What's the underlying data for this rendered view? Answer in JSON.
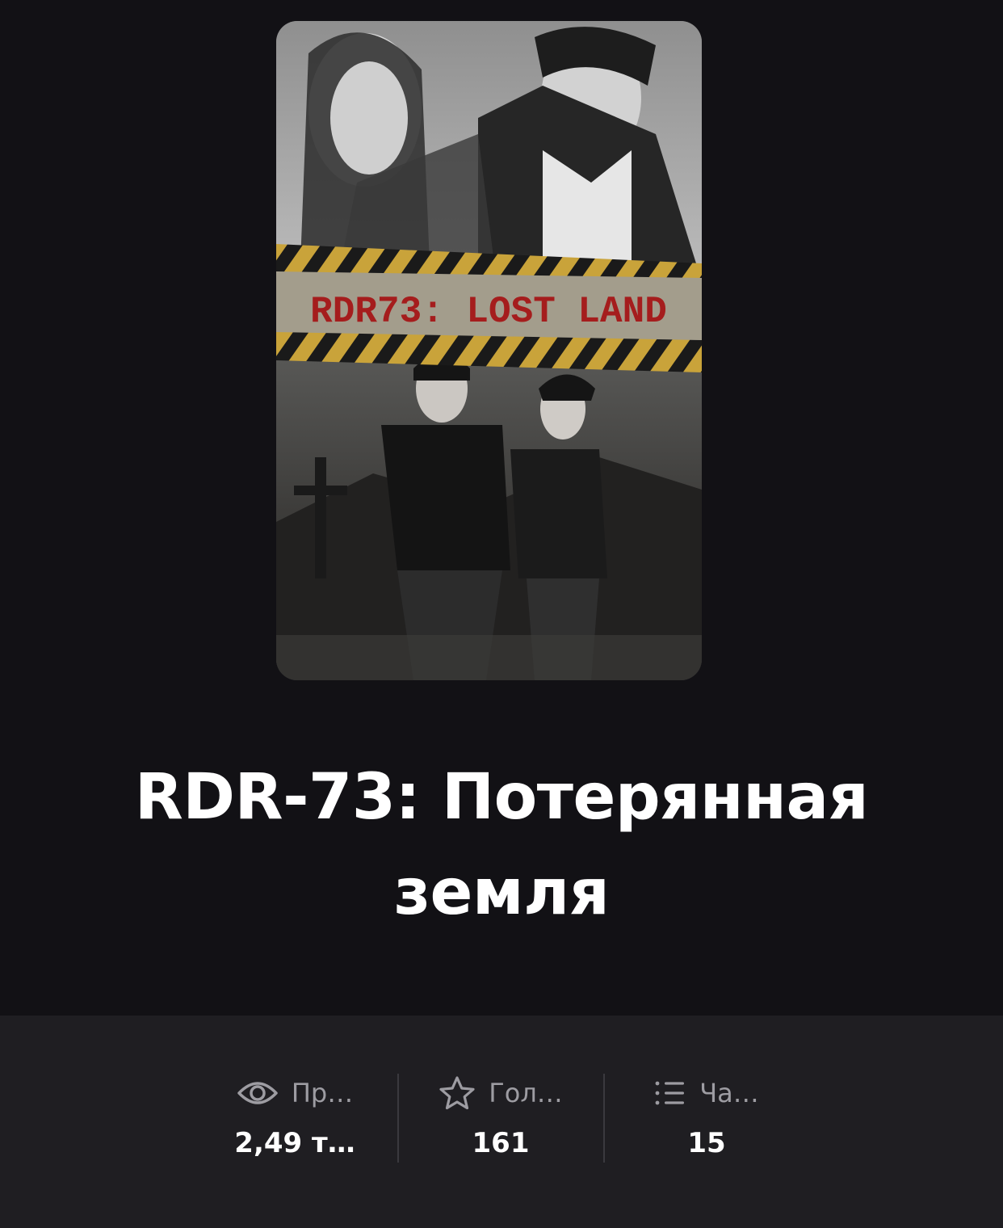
{
  "cover": {
    "image_alt": "Story cover",
    "cover_text": "RDR73: LOST LAND"
  },
  "story": {
    "title": "RDR-73: Потерянная земля"
  },
  "stats": [
    {
      "icon": "eye-icon",
      "label": "Пр…",
      "value": "2,49 т…"
    },
    {
      "icon": "star-icon",
      "label": "Гол…",
      "value": "161"
    },
    {
      "icon": "list-icon",
      "label": "Ча…",
      "value": "15"
    }
  ],
  "colors": {
    "background": "#121115",
    "stats_background": "#1f1e22",
    "label": "#9d9ca2",
    "value": "#ffffff",
    "tape_yellow": "#c9a33a",
    "cover_text_red": "#a51d1d"
  }
}
